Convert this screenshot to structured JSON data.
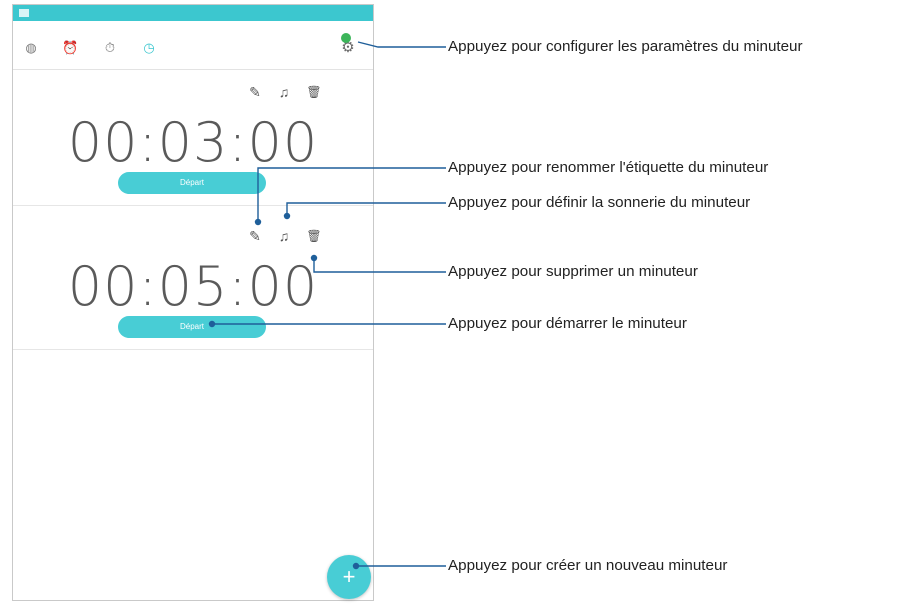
{
  "status_bar": {
    "right_text": ""
  },
  "tabs": [
    {
      "name": "tab-world-clock",
      "icon": "globe-icon",
      "glyph": "◍"
    },
    {
      "name": "tab-alarm",
      "icon": "alarm-clock-icon",
      "glyph": "⏰"
    },
    {
      "name": "tab-stopwatch",
      "icon": "stopwatch-icon",
      "glyph": "⏱"
    },
    {
      "name": "tab-timer",
      "icon": "timer-icon",
      "glyph": "◷",
      "active": true
    }
  ],
  "settings_icon": {
    "icon": "gear-icon",
    "glyph": "⚙"
  },
  "timers": [
    {
      "time": "00:03:00",
      "start_label": "Départ"
    },
    {
      "time": "00:05:00",
      "start_label": "Départ"
    }
  ],
  "timer_icons": {
    "rename": "✎",
    "ringtone": "♫",
    "delete": "🗑"
  },
  "fab": {
    "icon": "plus-icon",
    "glyph": "+"
  },
  "callouts": {
    "settings": "Appuyez pour configurer les paramètres du minuteur",
    "rename": "Appuyez pour renommer l'étiquette du minuteur",
    "ringtone": "Appuyez pour définir la sonnerie du minuteur",
    "delete": "Appuyez pour supprimer un minuteur",
    "start": "Appuyez pour démarrer le minuteur",
    "add": "Appuyez pour créer un nouveau minuteur"
  },
  "colors": {
    "accent": "#48cdd5",
    "status_bar": "#3cc7cf",
    "callout_line": "#1f5f9a",
    "indicator": "#3cb55a"
  }
}
